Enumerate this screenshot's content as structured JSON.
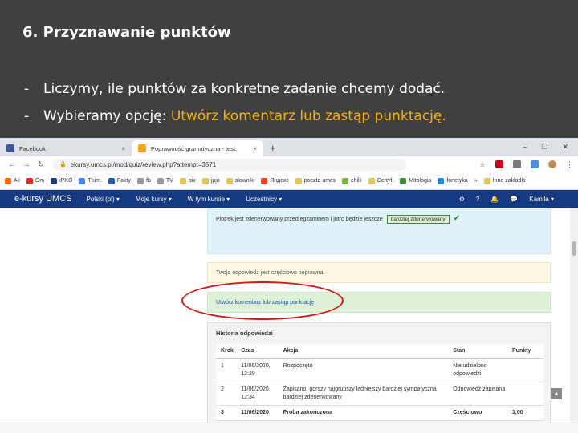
{
  "slide": {
    "title": "6. Przyznawanie punktów",
    "bullets": [
      {
        "dash": "-",
        "text": "Liczymy, ile punktów za konkretne zadanie chcemy dodać.",
        "highlight": ""
      },
      {
        "dash": "-",
        "text": "Wybieramy opcję: ",
        "highlight": "Utwórz komentarz lub zastąp punktację."
      }
    ],
    "highlight_color": "#f5b400"
  },
  "browser": {
    "tabs": [
      {
        "label": "Facebook",
        "close": "×"
      },
      {
        "label": "Poprawność gramatyczna - test: ",
        "close": "×"
      }
    ],
    "new_tab": "+",
    "window_controls": [
      "–",
      "❐",
      "✕"
    ],
    "url": "ekursy.umcs.pl/mod/quiz/review.php?attempt=3571",
    "bookmarks": [
      "Ali",
      "Gm",
      "iPKO",
      "Tłum.",
      "Fakty",
      "fb",
      "TV",
      "pix",
      "jpjo",
      "słowniki",
      "Яндекс",
      "poczta umcs",
      "chilli",
      "Certyf.",
      "Mitologia",
      "fonetyka",
      "»",
      "Inne zakładki"
    ]
  },
  "moodle": {
    "brand": "e-kursy UMCS",
    "menu": [
      "Polski (pl) ▾",
      "Moje kursy ▾",
      "W tym kursie ▾",
      "Uczestnicy ▾"
    ],
    "user": "Kamila ▾"
  },
  "question": {
    "sentence": "Piotrek jest zdenerwowany przed egzaminem i jutro będzie jeszcze",
    "answer": "bardziej zdenerwowany"
  },
  "feedback_partial": "Twoja odpowiedź jest częściowo poprawna.",
  "comment_link": "Utwórz komentarz lub zastąp punktację",
  "history": {
    "title": "Historia odpowiedzi",
    "headers": [
      "Krok",
      "Czas",
      "Akcja",
      "Stan",
      "Punkty"
    ],
    "rows": [
      [
        "1",
        "11/06/2020, 12:29",
        "Rozpoczęto",
        "Nie udzielono odpowiedzi",
        ""
      ],
      [
        "2",
        "11/06/2020, 12:34",
        "Zapisano: gorszy najgrubszy ładniejszy bardziej sympatyczna bardziej zdenerwowany",
        "Odpowiedź zapisana",
        ""
      ],
      [
        "3",
        "11/06/2020",
        "Próba zakończona",
        "Częściowo",
        "1,00"
      ]
    ]
  }
}
